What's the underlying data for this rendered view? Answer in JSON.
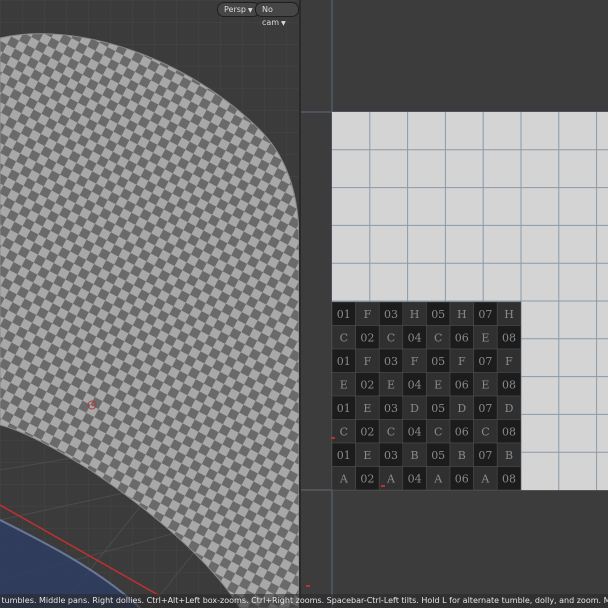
{
  "viewport3d": {
    "camera_mode_label": "Persp",
    "camera_select_label": "No cam"
  },
  "uv_grid": {
    "rows": [
      [
        "01",
        "F",
        "03",
        "H",
        "05",
        "H",
        "07",
        "H"
      ],
      [
        "C",
        "02",
        "C",
        "04",
        "C",
        "06",
        "E",
        "08"
      ],
      [
        "01",
        "F",
        "03",
        "F",
        "05",
        "F",
        "07",
        "F"
      ],
      [
        "E",
        "02",
        "E",
        "04",
        "E",
        "06",
        "E",
        "08"
      ],
      [
        "01",
        "E",
        "03",
        "D",
        "05",
        "D",
        "07",
        "D"
      ],
      [
        "C",
        "02",
        "C",
        "04",
        "C",
        "06",
        "C",
        "08"
      ],
      [
        "01",
        "E",
        "03",
        "B",
        "05",
        "B",
        "07",
        "B"
      ],
      [
        "A",
        "02",
        "A",
        "04",
        "A",
        "06",
        "A",
        "08"
      ]
    ]
  },
  "statusbar": {
    "text": "e tumbles. Middle pans. Right dollies. Ctrl+Alt+Left box-zooms. Ctrl+Right zooms. Spacebar-Ctrl-Left tilts. Hold L for alternate tumble, dolly, and zoom. M or Alt+M for First Person Navi"
  },
  "colors": {
    "viewport_bg": "#3b3b3b",
    "uv_bg": "#3c3c3c",
    "uv_tile_light": "#d4d4d4",
    "uv_tile_dark": "#1e1e1e",
    "axis_red": "#c03030"
  }
}
